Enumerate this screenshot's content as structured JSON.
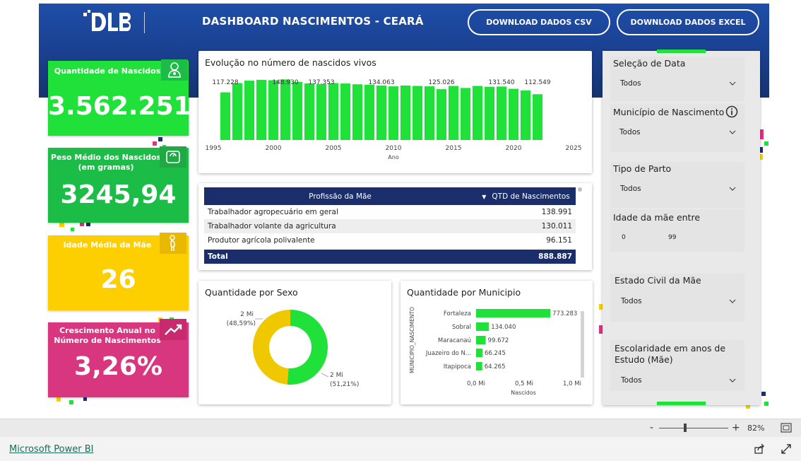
{
  "header": {
    "title": "DASHBOARD NASCIMENTOS - CEARÁ",
    "csv_button": "DOWNLOAD DADOS CSV",
    "excel_button": "DOWNLOAD DADOS EXCEL",
    "logo_icon": "dlb-logo"
  },
  "kpis": [
    {
      "label": "Quantidade de Nascidos",
      "value": "3.562.251",
      "icon": "baby-icon",
      "color": "#1fe13a"
    },
    {
      "label": "Peso Médio dos Nascidos (em gramas)",
      "value": "3245,94",
      "icon": "scale-icon",
      "color": "#1bbd47"
    },
    {
      "label": "Idade Média da Mãe",
      "value": "26",
      "icon": "pregnant-woman-icon",
      "color": "#fecf00"
    },
    {
      "label": "Crescimento Anual no Número de Nascimentos",
      "value": "3,26%",
      "icon": "trend-up-icon",
      "color": "#d8367e"
    }
  ],
  "line_chart": {
    "title": "Evolução no número de nascidos vivos",
    "xlabel": "Ano",
    "x_ticks": [
      "1995",
      "2000",
      "2005",
      "2010",
      "2015",
      "2020",
      "2025"
    ],
    "data_labels": [
      {
        "year": 1996,
        "text": "117.228"
      },
      {
        "year": 2001,
        "text": "148.930"
      },
      {
        "year": 2004,
        "text": "137.353"
      },
      {
        "year": 2009,
        "text": "134.063"
      },
      {
        "year": 2014,
        "text": "125.026"
      },
      {
        "year": 2019,
        "text": "131.540"
      },
      {
        "year": 2022,
        "text": "112.549"
      }
    ]
  },
  "table": {
    "col1": "Profissão da Mãe",
    "col2": "QTD de Nascimentos",
    "rows": [
      {
        "name": "Trabalhador agropecuário em geral",
        "value": "138.991"
      },
      {
        "name": "Trabalhador volante da agricultura",
        "value": "130.011"
      },
      {
        "name": "Produtor agrícola polivalente",
        "value": "96.151"
      }
    ],
    "total_label": "Total",
    "total_value": "888.887"
  },
  "sex_chart": {
    "title": "Quantidade por Sexo",
    "slice_a": {
      "value_label": "2 Mi",
      "pct_label": "(48,59%)",
      "pct": 48.59,
      "color": "#f0c800"
    },
    "slice_b": {
      "value_label": "2 Mi",
      "pct_label": "(51,21%)",
      "pct": 51.21,
      "color": "#1fe13a"
    }
  },
  "muni_chart": {
    "title": "Quantidade por Municipio",
    "ylabel": "MUNICIPIO_NASCIMENTO",
    "xlabel": "Nascidos",
    "x_ticks": [
      "0,0 Mi",
      "0,5 Mi",
      "1,0 Mi"
    ]
  },
  "filters": {
    "date": {
      "title": "Seleção de Data",
      "value": "Todos"
    },
    "municipio": {
      "title": "Município de Nascimento",
      "value": "Todos",
      "icon": "info-icon"
    },
    "parto": {
      "title": "Tipo de Parto",
      "value": "Todos"
    },
    "idade": {
      "title": "Idade da mãe entre",
      "min": "0",
      "max": "99"
    },
    "civil": {
      "title": "Estado Civil da Mãe",
      "value": "Todos"
    },
    "escolaridade": {
      "title": "Escolaridade em anos de Estudo (Mãe)",
      "value": "Todos"
    }
  },
  "zoom": {
    "minus": "-",
    "plus": "+",
    "level": "82%",
    "fit_icon": "fit-to-page-icon"
  },
  "footer": {
    "link": "Microsoft Power BI",
    "share_icon": "share-icon",
    "expand_icon": "expand-icon"
  },
  "chart_data": [
    {
      "type": "bar",
      "title": "Evolução no número de nascidos vivos",
      "xlabel": "Ano",
      "ylabel": "",
      "x": [
        1996,
        1997,
        1998,
        1999,
        2000,
        2001,
        2002,
        2003,
        2004,
        2005,
        2006,
        2007,
        2008,
        2009,
        2010,
        2011,
        2012,
        2013,
        2014,
        2015,
        2016,
        2017,
        2018,
        2019,
        2020,
        2021,
        2022
      ],
      "values": [
        117228,
        140000,
        146000,
        148000,
        147000,
        148930,
        143000,
        139000,
        137353,
        140000,
        139000,
        137000,
        136000,
        134063,
        132000,
        134000,
        133000,
        132000,
        125026,
        133000,
        128000,
        133000,
        131000,
        131540,
        126000,
        122000,
        112549
      ],
      "xlim": [
        1995,
        2025
      ],
      "color": "#1fe13a"
    },
    {
      "type": "bar",
      "title": "Quantidade por Municipio",
      "xlabel": "Nascidos",
      "ylabel": "MUNICIPIO_NASCIMENTO",
      "categories": [
        "Fortaleza",
        "Sobral",
        "Maracanaú",
        "Juazeiro do N...",
        "Itapipoca"
      ],
      "values": [
        773283,
        134040,
        99672,
        66245,
        64265
      ],
      "value_labels": [
        "773.283",
        "134.040",
        "99.672",
        "66.245",
        "64.265"
      ],
      "xlim": [
        0,
        1000000
      ],
      "color": "#1fe13a"
    },
    {
      "type": "pie",
      "title": "Quantidade por Sexo",
      "labels": [
        "2 Mi (48,59%)",
        "2 Mi (51,21%)"
      ],
      "values": [
        48.59,
        51.21
      ],
      "colors": [
        "#f0c800",
        "#1fe13a"
      ]
    }
  ]
}
